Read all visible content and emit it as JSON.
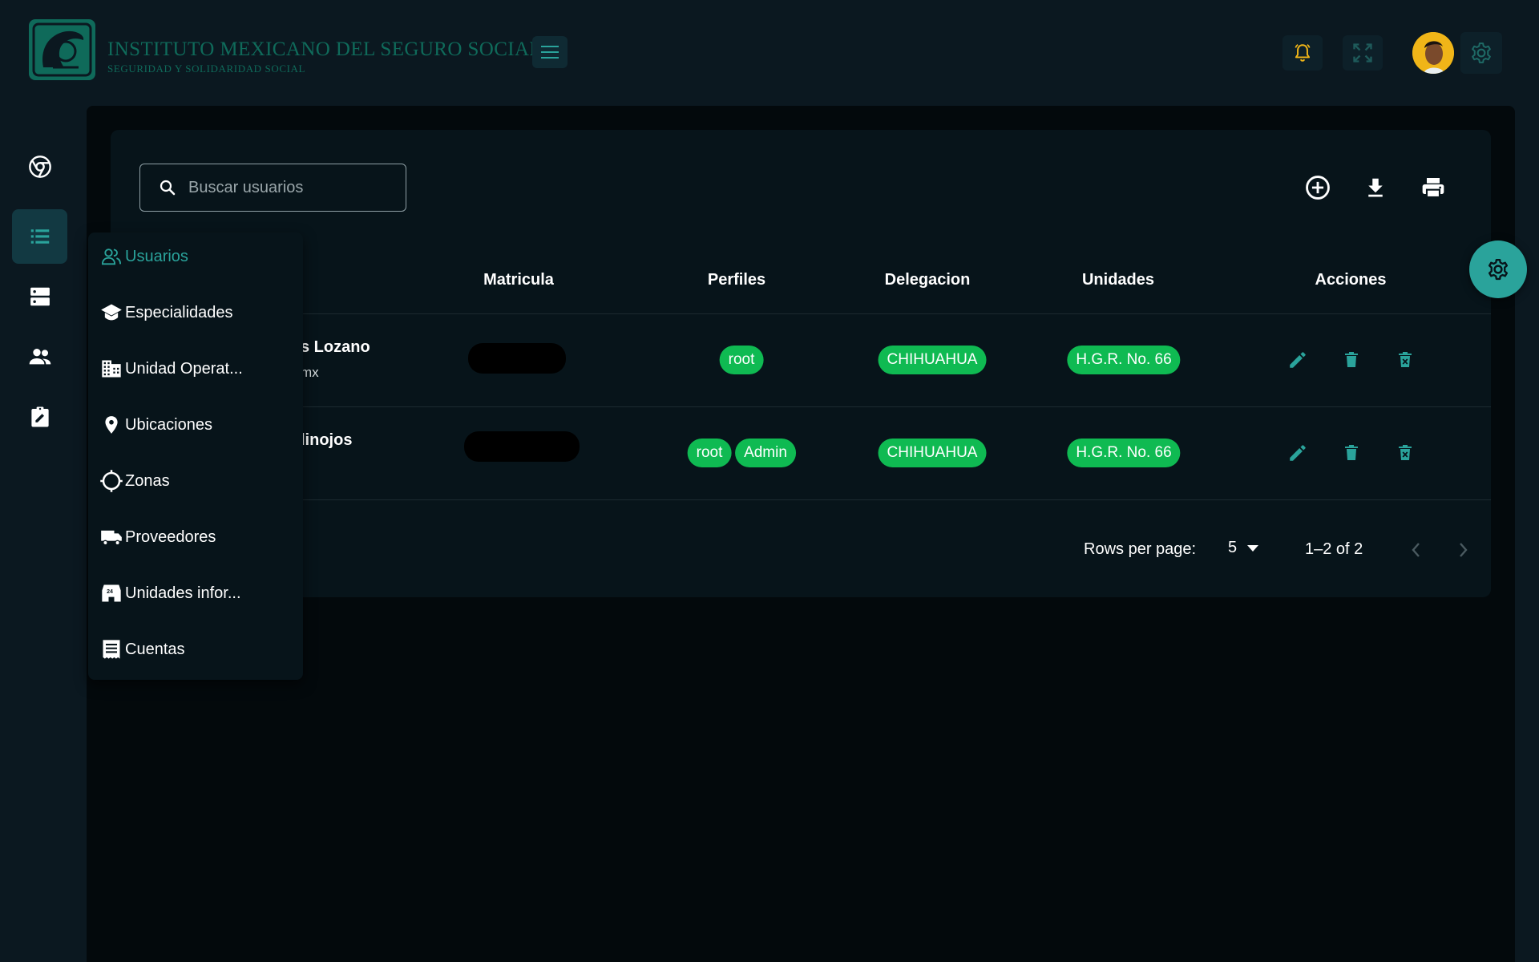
{
  "header": {
    "brand_title": "INSTITUTO MEXICANO DEL SEGURO SOCIAL",
    "brand_subtitle": "SEGURIDAD Y SOLIDARIDAD SOCIAL",
    "icons": [
      "menu-icon",
      "bell-icon",
      "fullscreen-icon",
      "avatar",
      "gear-icon"
    ]
  },
  "rail": {
    "items": [
      {
        "icon": "chrome-icon",
        "active": false
      },
      {
        "icon": "list-icon",
        "active": true
      },
      {
        "icon": "dns-icon",
        "active": false
      },
      {
        "icon": "people-icon",
        "active": false
      },
      {
        "icon": "assignment-edit-icon",
        "active": false
      }
    ]
  },
  "menu": {
    "items": [
      {
        "label": "Usuarios",
        "icon": "users-icon",
        "active": true
      },
      {
        "label": "Especialidades",
        "icon": "school-icon"
      },
      {
        "label": "Unidad Operat...",
        "icon": "building-icon"
      },
      {
        "label": "Ubicaciones",
        "icon": "location-pin-icon"
      },
      {
        "label": "Zonas",
        "icon": "target-icon"
      },
      {
        "label": "Proveedores",
        "icon": "truck-icon"
      },
      {
        "label": "Unidades infor...",
        "icon": "store-24-icon"
      },
      {
        "label": "Cuentas",
        "icon": "receipt-icon"
      }
    ]
  },
  "search": {
    "placeholder": "Buscar usuarios"
  },
  "toolbar": {
    "icons": [
      "add-circle-icon",
      "download-icon",
      "print-icon"
    ]
  },
  "table": {
    "columns": [
      "Matricula",
      "Perfiles",
      "Delegacion",
      "Unidades",
      "Acciones"
    ],
    "rows": [
      {
        "name": "s Lozano",
        "email": "mx",
        "profiles": [
          "root"
        ],
        "delegacion": "CHIHUAHUA",
        "unidad": "H.G.R. No. 66"
      },
      {
        "name": "linojos",
        "email": "",
        "profiles": [
          "root",
          "Admin"
        ],
        "delegacion": "CHIHUAHUA",
        "unidad": "H.G.R. No. 66"
      }
    ]
  },
  "pagination": {
    "rows_per_page_label": "Rows per page:",
    "rows_per_page_value": "5",
    "range": "1–2 of 2"
  },
  "colors": {
    "background": "#0b1820",
    "panel": "#03090c",
    "card": "#07141a",
    "accent": "#2aa39b",
    "chip": "#0fba52",
    "brand": "#0f6a5a",
    "bell": "#f0b518"
  }
}
